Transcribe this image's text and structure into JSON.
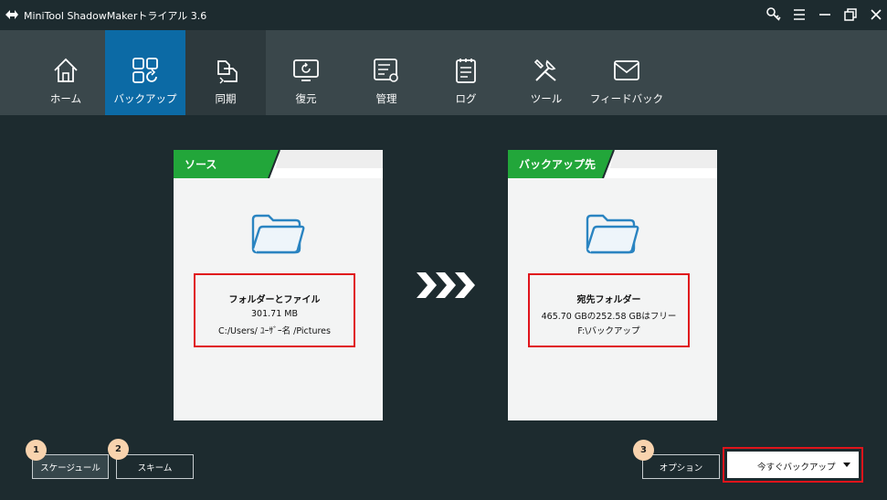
{
  "window": {
    "title": "MiniTool ShadowMakerトライアル 3.6"
  },
  "nav": {
    "items": [
      {
        "id": "home",
        "label": "ホーム",
        "icon": "home-icon"
      },
      {
        "id": "backup",
        "label": "バックアップ",
        "icon": "backup-icon",
        "active": true
      },
      {
        "id": "sync",
        "label": "同期",
        "icon": "sync-icon"
      },
      {
        "id": "restore",
        "label": "復元",
        "icon": "restore-icon"
      },
      {
        "id": "manage",
        "label": "管理",
        "icon": "manage-icon"
      },
      {
        "id": "log",
        "label": "ログ",
        "icon": "log-icon"
      },
      {
        "id": "tools",
        "label": "ツール",
        "icon": "tools-icon"
      },
      {
        "id": "feedback",
        "label": "フィードバック",
        "icon": "mail-icon"
      }
    ]
  },
  "source": {
    "header": "ソース",
    "title": "フォルダーとファイル",
    "size": "301.71 MB",
    "path": "C:/Users/ ﾕｰｻﾞｰ名 /Pictures"
  },
  "destination": {
    "header": "バックアップ先",
    "title": "宛先フォルダー",
    "space": "465.70 GBの252.58 GBはフリー",
    "path": "F:\\バックアップ"
  },
  "buttons": {
    "schedule": "スケージュール",
    "scheme": "スキーム",
    "options": "オプション",
    "backup_now": "今すぐバックアップ"
  },
  "badges": {
    "one": "1",
    "two": "2",
    "three": "3"
  },
  "colors": {
    "accent_blue": "#0c6aa5",
    "header_green": "#22a63a",
    "highlight_red": "#e0141b",
    "badge": "#f8d3ae"
  }
}
